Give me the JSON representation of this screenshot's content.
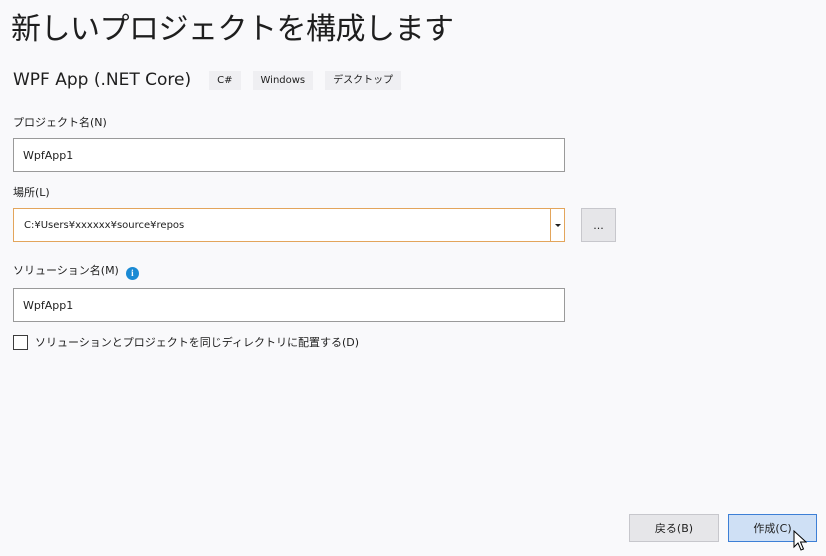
{
  "page": {
    "title": "新しいプロジェクトを構成します"
  },
  "template": {
    "name": "WPF App (.NET Core)",
    "tags": [
      "C#",
      "Windows",
      "デスクトップ"
    ]
  },
  "project_name": {
    "label": "プロジェクト名(N)",
    "value": "WpfApp1"
  },
  "location": {
    "label": "場所(L)",
    "value": "C:¥Users¥xxxxxx¥source¥repos",
    "browse_label": "..."
  },
  "solution_name": {
    "label": "ソリューション名(M)",
    "info_icon": "i",
    "value": "WpfApp1"
  },
  "same_directory": {
    "label": "ソリューションとプロジェクトを同じディレクトリに配置する(D)",
    "checked": false
  },
  "footer": {
    "back_label": "戻る(B)",
    "create_label": "作成(C)"
  },
  "colors": {
    "background": "#f9f9fb",
    "focus_border": "#e3a55b",
    "primary_button": "#cfe0f5",
    "primary_border": "#3d7fd6",
    "info_icon": "#1a8ad4"
  }
}
